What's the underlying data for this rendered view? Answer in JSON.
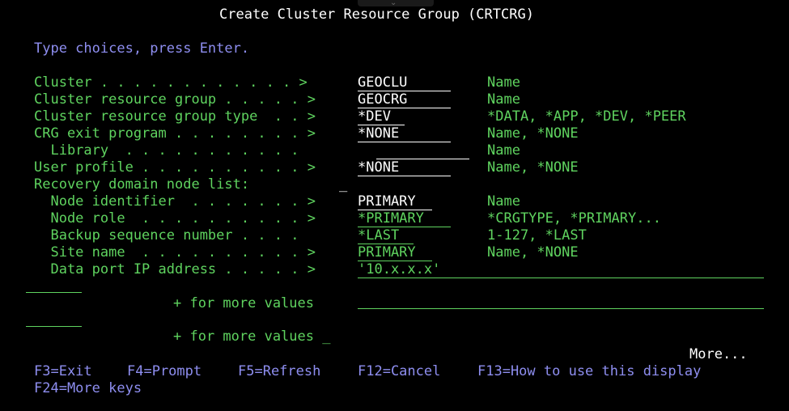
{
  "title": "Create Cluster Resource Group (CRTCRG)",
  "instruction": "Type choices, press Enter.",
  "params": [
    {
      "label": "Cluster . . . . . . . . . . . . >",
      "value": "GEOCLU",
      "hint": "Name"
    },
    {
      "label": "Cluster resource group . . . . . >",
      "value": "GEOCRG",
      "hint": "Name"
    },
    {
      "label": "Cluster resource group type  . . >",
      "value": "*DEV",
      "hint": "*DATA, *APP, *DEV, *PEER"
    },
    {
      "label": "CRG exit program . . . . . . . . >",
      "value": "*NONE",
      "hint": "Name, *NONE"
    },
    {
      "label": "  Library  . . . . . . . . . . .",
      "value": "",
      "hint": "Name"
    },
    {
      "label": "User profile . . . . . . . . . . >",
      "value": "*NONE",
      "hint": "Name, *NONE"
    },
    {
      "label": "Recovery domain node list:",
      "value": "_",
      "hint": ""
    },
    {
      "label": "  Node identifier  . . . . . . . >",
      "value": "PRIMARY",
      "hint": "Name"
    },
    {
      "label": "  Node role  . . . . . . . . . . >",
      "value": "*PRIMARY",
      "hint": "*CRGTYPE, *PRIMARY..."
    },
    {
      "label": "  Backup sequence number . . . . ",
      "value": "*LAST",
      "hint": "1-127, *LAST"
    },
    {
      "label": "  Site name  . . . . . . . . . . >",
      "value": "PRIMARY",
      "hint": "Name, *NONE"
    },
    {
      "label": "  Data port IP address . . . . . >",
      "value": "'10.x.x.x'",
      "hint": ""
    }
  ],
  "more_values_1": "+ for more values",
  "more_values_2": "+ for more values _",
  "more": "More...",
  "fkeys": [
    {
      "label": "F3=Exit"
    },
    {
      "label": "F4=Prompt"
    },
    {
      "label": "F5=Refresh"
    },
    {
      "label": "F12=Cancel"
    },
    {
      "label": "F13=How to use this display"
    },
    {
      "label": "F24=More keys"
    }
  ]
}
